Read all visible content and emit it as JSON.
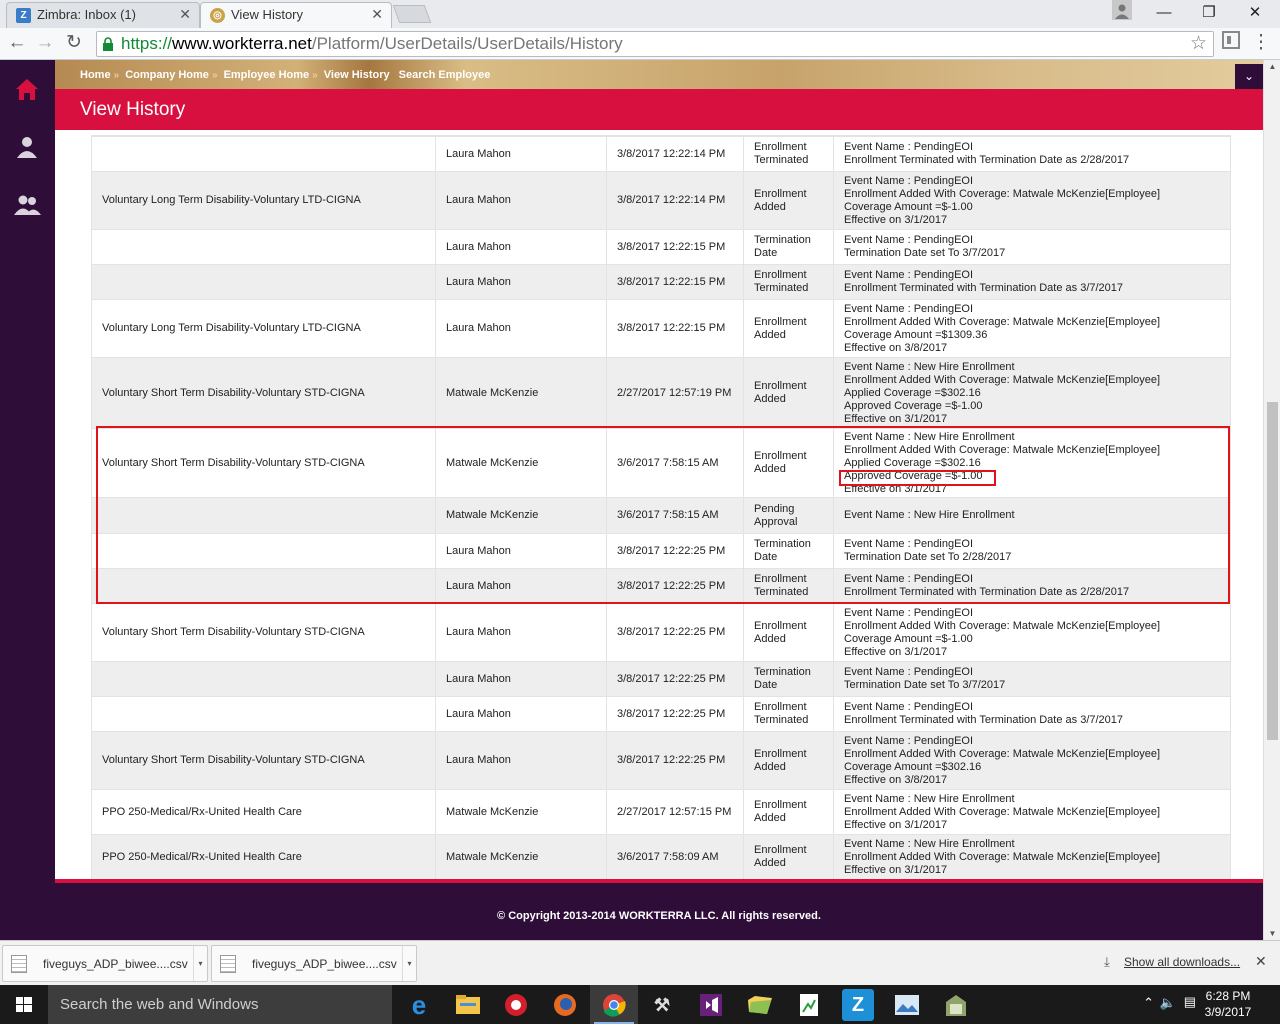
{
  "browser": {
    "tabs": [
      {
        "title": "Zimbra: Inbox (1)",
        "icon": "zimbra-icon"
      },
      {
        "title": "View History",
        "icon": "workterra-icon"
      }
    ],
    "url_scheme": "https://",
    "url_host": "www.workterra.net",
    "url_path": "/Platform/UserDetails/UserDetails/History"
  },
  "breadcrumb": [
    "Home",
    "Company Home",
    "Employee Home",
    "View History",
    "Search Employee"
  ],
  "page_title": "View History",
  "history_rows": [
    {
      "plan": "",
      "user": "Laura Mahon",
      "date": "3/8/2017 12:22:14 PM",
      "action": [
        "Enrollment",
        "Terminated"
      ],
      "details": [
        "Event Name : PendingEOI",
        "Enrollment Terminated with Termination Date as 2/28/2017"
      ]
    },
    {
      "plan": "Voluntary Long Term Disability-Voluntary LTD-CIGNA",
      "user": "Laura Mahon",
      "date": "3/8/2017 12:22:14 PM",
      "action": [
        "Enrollment",
        "Added"
      ],
      "details": [
        "Event Name : PendingEOI",
        "Enrollment Added With Coverage: Matwale McKenzie[Employee]",
        "Coverage Amount =$-1.00",
        "Effective on 3/1/2017"
      ]
    },
    {
      "plan": "",
      "user": "Laura Mahon",
      "date": "3/8/2017 12:22:15 PM",
      "action": [
        "Termination",
        "Date"
      ],
      "details": [
        "Event Name : PendingEOI",
        "Termination Date set To 3/7/2017"
      ]
    },
    {
      "plan": "",
      "user": "Laura Mahon",
      "date": "3/8/2017 12:22:15 PM",
      "action": [
        "Enrollment",
        "Terminated"
      ],
      "details": [
        "Event Name : PendingEOI",
        "Enrollment Terminated with Termination Date as 3/7/2017"
      ]
    },
    {
      "plan": "Voluntary Long Term Disability-Voluntary LTD-CIGNA",
      "user": "Laura Mahon",
      "date": "3/8/2017 12:22:15 PM",
      "action": [
        "Enrollment",
        "Added"
      ],
      "details": [
        "Event Name : PendingEOI",
        "Enrollment Added With Coverage: Matwale McKenzie[Employee]",
        "Coverage Amount =$1309.36",
        "Effective on 3/8/2017"
      ]
    },
    {
      "plan": "Voluntary Short Term Disability-Voluntary STD-CIGNA",
      "user": "Matwale McKenzie",
      "date": "2/27/2017 12:57:19 PM",
      "action": [
        "Enrollment",
        "Added"
      ],
      "details": [
        "Event Name : New Hire Enrollment",
        "Enrollment Added With Coverage: Matwale McKenzie[Employee]",
        "Applied Coverage =$302.16",
        "Approved Coverage =$-1.00",
        "Effective on 3/1/2017"
      ]
    },
    {
      "plan": "Voluntary Short Term Disability-Voluntary STD-CIGNA",
      "user": "Matwale McKenzie",
      "date": "3/6/2017 7:58:15 AM",
      "action": [
        "Enrollment",
        "Added"
      ],
      "details": [
        "Event Name : New Hire Enrollment",
        "Enrollment Added With Coverage: Matwale McKenzie[Employee]",
        "Applied Coverage =$302.16",
        "Approved Coverage =$-1.00",
        "Effective on 3/1/2017"
      ]
    },
    {
      "plan": "",
      "user": "Matwale McKenzie",
      "date": "3/6/2017 7:58:15 AM",
      "action": [
        "Pending",
        "Approval"
      ],
      "details": [
        "Event Name : New Hire Enrollment"
      ]
    },
    {
      "plan": "",
      "user": "Laura Mahon",
      "date": "3/8/2017 12:22:25 PM",
      "action": [
        "Termination",
        "Date"
      ],
      "details": [
        "Event Name : PendingEOI",
        "Termination Date set To 2/28/2017"
      ]
    },
    {
      "plan": "",
      "user": "Laura Mahon",
      "date": "3/8/2017 12:22:25 PM",
      "action": [
        "Enrollment",
        "Terminated"
      ],
      "details": [
        "Event Name : PendingEOI",
        "Enrollment Terminated with Termination Date as 2/28/2017"
      ]
    },
    {
      "plan": "Voluntary Short Term Disability-Voluntary STD-CIGNA",
      "user": "Laura Mahon",
      "date": "3/8/2017 12:22:25 PM",
      "action": [
        "Enrollment",
        "Added"
      ],
      "details": [
        "Event Name : PendingEOI",
        "Enrollment Added With Coverage: Matwale McKenzie[Employee]",
        "Coverage Amount =$-1.00",
        "Effective on 3/1/2017"
      ]
    },
    {
      "plan": "",
      "user": "Laura Mahon",
      "date": "3/8/2017 12:22:25 PM",
      "action": [
        "Termination",
        "Date"
      ],
      "details": [
        "Event Name : PendingEOI",
        "Termination Date set To 3/7/2017"
      ]
    },
    {
      "plan": "",
      "user": "Laura Mahon",
      "date": "3/8/2017 12:22:25 PM",
      "action": [
        "Enrollment",
        "Terminated"
      ],
      "details": [
        "Event Name : PendingEOI",
        "Enrollment Terminated with Termination Date as 3/7/2017"
      ]
    },
    {
      "plan": "Voluntary Short Term Disability-Voluntary STD-CIGNA",
      "user": "Laura Mahon",
      "date": "3/8/2017 12:22:25 PM",
      "action": [
        "Enrollment",
        "Added"
      ],
      "details": [
        "Event Name : PendingEOI",
        "Enrollment Added With Coverage: Matwale McKenzie[Employee]",
        "Coverage Amount =$302.16",
        "Effective on 3/8/2017"
      ]
    },
    {
      "plan": "PPO 250-Medical/Rx-United Health Care",
      "user": "Matwale McKenzie",
      "date": "2/27/2017 12:57:15 PM",
      "action": [
        "Enrollment",
        "Added"
      ],
      "details": [
        "Event Name : New Hire Enrollment",
        "Enrollment Added With Coverage: Matwale McKenzie[Employee]",
        "Effective on 3/1/2017"
      ]
    },
    {
      "plan": "PPO 250-Medical/Rx-United Health Care",
      "user": "Matwale McKenzie",
      "date": "3/6/2017 7:58:09 AM",
      "action": [
        "Enrollment",
        "Added"
      ],
      "details": [
        "Event Name : New Hire Enrollment",
        "Enrollment Added With Coverage: Matwale McKenzie[Employee]",
        "Effective on 3/1/2017"
      ]
    }
  ],
  "footer": {
    "copyright": "© Copyright 2013-2014 WORKTERRA LLC. All rights reserved."
  },
  "downloads": {
    "items": [
      "fiveguys_ADP_biwee....csv",
      "fiveguys_ADP_biwee....csv"
    ],
    "show_all": "Show all downloads..."
  },
  "taskbar": {
    "search_placeholder": "Search the web and Windows",
    "time": "6:28 PM",
    "date": "3/9/2017"
  },
  "colors": {
    "accent": "#d8103f",
    "nav": "#2f0d39",
    "annotation": "#e0121a"
  }
}
